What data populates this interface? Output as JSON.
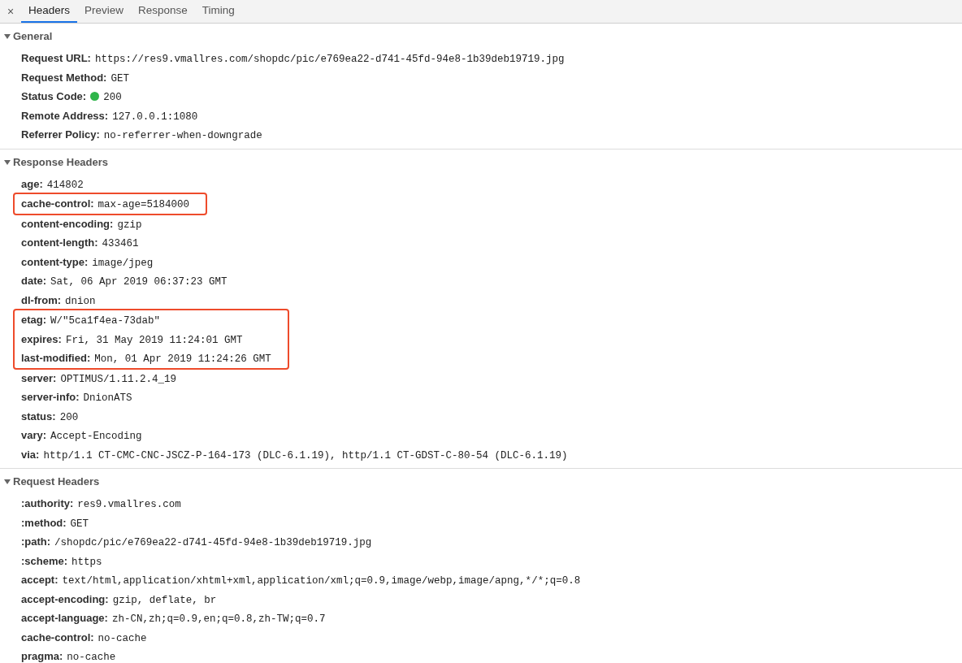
{
  "tabs_bar": {
    "close": "×",
    "tabs": [
      {
        "label": "Headers",
        "selected": true
      },
      {
        "label": "Preview",
        "selected": false
      },
      {
        "label": "Response",
        "selected": false
      },
      {
        "label": "Timing",
        "selected": false
      }
    ]
  },
  "sections": [
    {
      "title": "General",
      "expanded": true,
      "rows": [
        {
          "name": "Request URL:",
          "value": "https://res9.vmallres.com/shopdc/pic/e769ea22-d741-45fd-94e8-1b39deb19719.jpg",
          "highlighted": false
        },
        {
          "name": "Request Method:",
          "value": "GET",
          "highlighted": false
        },
        {
          "name": "Status Code:",
          "value": "200",
          "color": "#2fb54a",
          "highlighted": false
        },
        {
          "name": "Remote Address:",
          "value": "127.0.0.1:1080",
          "highlighted": false
        },
        {
          "name": "Referrer Policy:",
          "value": "no-referrer-when-downgrade",
          "highlighted": false
        }
      ]
    },
    {
      "title": "Response Headers",
      "expanded": true,
      "rows": [
        {
          "name": "age:",
          "value": "414802",
          "highlighted": false
        },
        {
          "name": "cache-control:",
          "value": "max-age=5184000",
          "highlighted": true
        },
        {
          "name": "content-encoding:",
          "value": "gzip",
          "highlighted": false
        },
        {
          "name": "content-length:",
          "value": "433461",
          "highlighted": false
        },
        {
          "name": "content-type:",
          "value": "image/jpeg",
          "highlighted": false
        },
        {
          "name": "date:",
          "value": "Sat, 06 Apr 2019 06:37:23 GMT",
          "highlighted": false
        },
        {
          "name": "dl-from:",
          "value": "dnion",
          "highlighted": false
        },
        {
          "name": "etag:",
          "value": "W/\"5ca1f4ea-73dab\"",
          "highlighted": true
        },
        {
          "name": "expires:",
          "value": "Fri, 31 May 2019 11:24:01 GMT",
          "highlighted": true
        },
        {
          "name": "last-modified:",
          "value": "Mon, 01 Apr 2019 11:24:26 GMT",
          "highlighted": true
        },
        {
          "name": "server:",
          "value": "OPTIMUS/1.11.2.4_19",
          "highlighted": false
        },
        {
          "name": "server-info:",
          "value": "DnionATS",
          "highlighted": false
        },
        {
          "name": "status:",
          "value": "200",
          "highlighted": false
        },
        {
          "name": "vary:",
          "value": "Accept-Encoding",
          "highlighted": false
        },
        {
          "name": "via:",
          "value": "http/1.1 CT-CMC-CNC-JSCZ-P-164-173 (DLC-6.1.19), http/1.1 CT-GDST-C-80-54 (DLC-6.1.19)",
          "highlighted": false
        }
      ]
    },
    {
      "title": "Request Headers",
      "expanded": true,
      "rows": [
        {
          "name": ":authority:",
          "value": "res9.vmallres.com",
          "highlighted": false
        },
        {
          "name": ":method:",
          "value": "GET",
          "highlighted": false
        },
        {
          "name": ":path:",
          "value": "/shopdc/pic/e769ea22-d741-45fd-94e8-1b39deb19719.jpg",
          "highlighted": false
        },
        {
          "name": ":scheme:",
          "value": "https",
          "highlighted": false
        },
        {
          "name": "accept:",
          "value": "text/html,application/xhtml+xml,application/xml;q=0.9,image/webp,image/apng,*/*;q=0.8",
          "highlighted": false
        },
        {
          "name": "accept-encoding:",
          "value": "gzip, deflate, br",
          "highlighted": false
        },
        {
          "name": "accept-language:",
          "value": "zh-CN,zh;q=0.9,en;q=0.8,zh-TW;q=0.7",
          "highlighted": false
        },
        {
          "name": "cache-control:",
          "value": "no-cache",
          "highlighted": false
        },
        {
          "name": "pragma:",
          "value": "no-cache",
          "highlighted": false
        }
      ]
    }
  ]
}
